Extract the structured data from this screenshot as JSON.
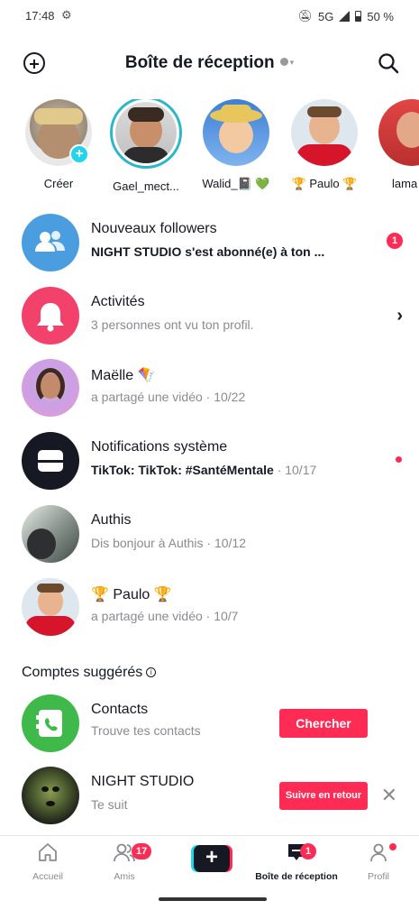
{
  "status": {
    "time": "17:48",
    "network": "5G",
    "battery": "50 %"
  },
  "header": {
    "title": "Boîte de réception"
  },
  "stories": [
    {
      "name": "Créer"
    },
    {
      "name": "Gael_mect..."
    },
    {
      "name": "Walid_📓 💚"
    },
    {
      "name": "🏆 Paulo 🏆"
    },
    {
      "name": "lama"
    }
  ],
  "inbox": [
    {
      "title": "Nouveaux followers",
      "subtitle": "NIGHT STUDIO s'est abonné(e) à ton ...",
      "badge": "1"
    },
    {
      "title": "Activités",
      "subtitle": "3 personnes ont vu ton profil."
    },
    {
      "title": "Maëlle 🪁",
      "subtitle": "a partagé une vidéo · 10/22"
    },
    {
      "title": "Notifications système",
      "subtitle": "TikTok: TikTok: #SantéMentale",
      "meta": "· 10/17"
    },
    {
      "title": "Authis",
      "subtitle": "Dis bonjour à Authis · 10/12"
    },
    {
      "title": "🏆 Paulo 🏆",
      "subtitle": "a partagé une vidéo · 10/7"
    }
  ],
  "suggested": {
    "heading": "Comptes suggérés",
    "items": [
      {
        "title": "Contacts",
        "subtitle": "Trouve tes contacts",
        "button": "Chercher"
      },
      {
        "title": "NIGHT STUDIO",
        "subtitle": "Te suit",
        "button": "Suivre en retour"
      }
    ]
  },
  "nav": {
    "home": "Accueil",
    "friends": "Amis",
    "friends_badge": "17",
    "inbox": "Boîte de réception",
    "inbox_badge": "1",
    "profile": "Profil"
  },
  "colors": {
    "accent": "#fe2c55",
    "cyan": "#20d5ec",
    "followers_blue": "#4a9ee0",
    "activity_pink": "#f2416a",
    "contacts_green": "#3fb94a"
  }
}
